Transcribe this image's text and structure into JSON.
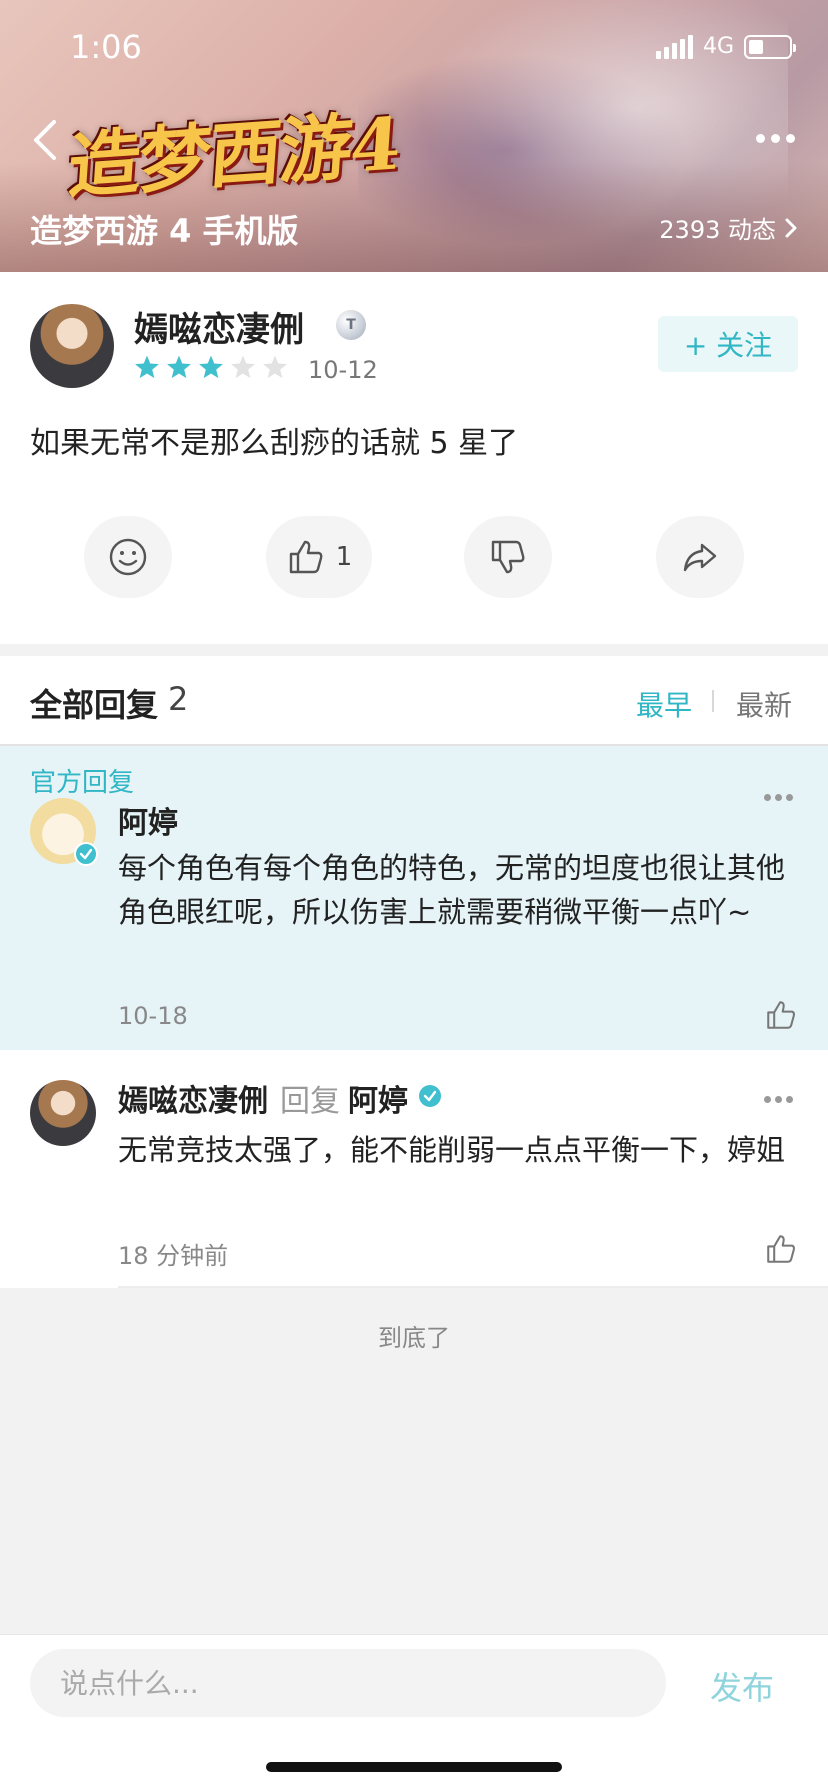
{
  "status_bar": {
    "time": "1:06",
    "network": "4G"
  },
  "header": {
    "logo_text": "造梦西游4",
    "game_title": "造梦西游 4 手机版",
    "dynamics_label": "2393 动态"
  },
  "post": {
    "username": "嫣嗞恋凄侀",
    "level_badge": "T",
    "rating": 3,
    "rating_max": 5,
    "date": "10-12",
    "follow_label": "+ 关注",
    "text": "如果无常不是那么刮痧的话就 5 星了",
    "like_count": "1"
  },
  "replies": {
    "title": "全部回复",
    "count": "2",
    "sort_earliest": "最早",
    "sort_newest": "最新",
    "official_label": "官方回复",
    "items": [
      {
        "author": "阿婷",
        "text": "每个角色有每个角色的特色，无常的坦度也很让其他角色眼红呢，所以伤害上就需要稍微平衡一点吖~",
        "time": "10-18"
      },
      {
        "author": "嫣嗞恋凄侀",
        "reply_word": "回复",
        "reply_to": "阿婷",
        "text": "无常竞技太强了，能不能削弱一点点平衡一下，婷姐",
        "time": "18 分钟前"
      }
    ],
    "end_tip": "到底了"
  },
  "composer": {
    "placeholder": "说点什么...",
    "publish_label": "发布"
  },
  "colors": {
    "accent": "#30b6c5",
    "star_on": "#40bfcf",
    "star_off": "#e2e2e2"
  }
}
